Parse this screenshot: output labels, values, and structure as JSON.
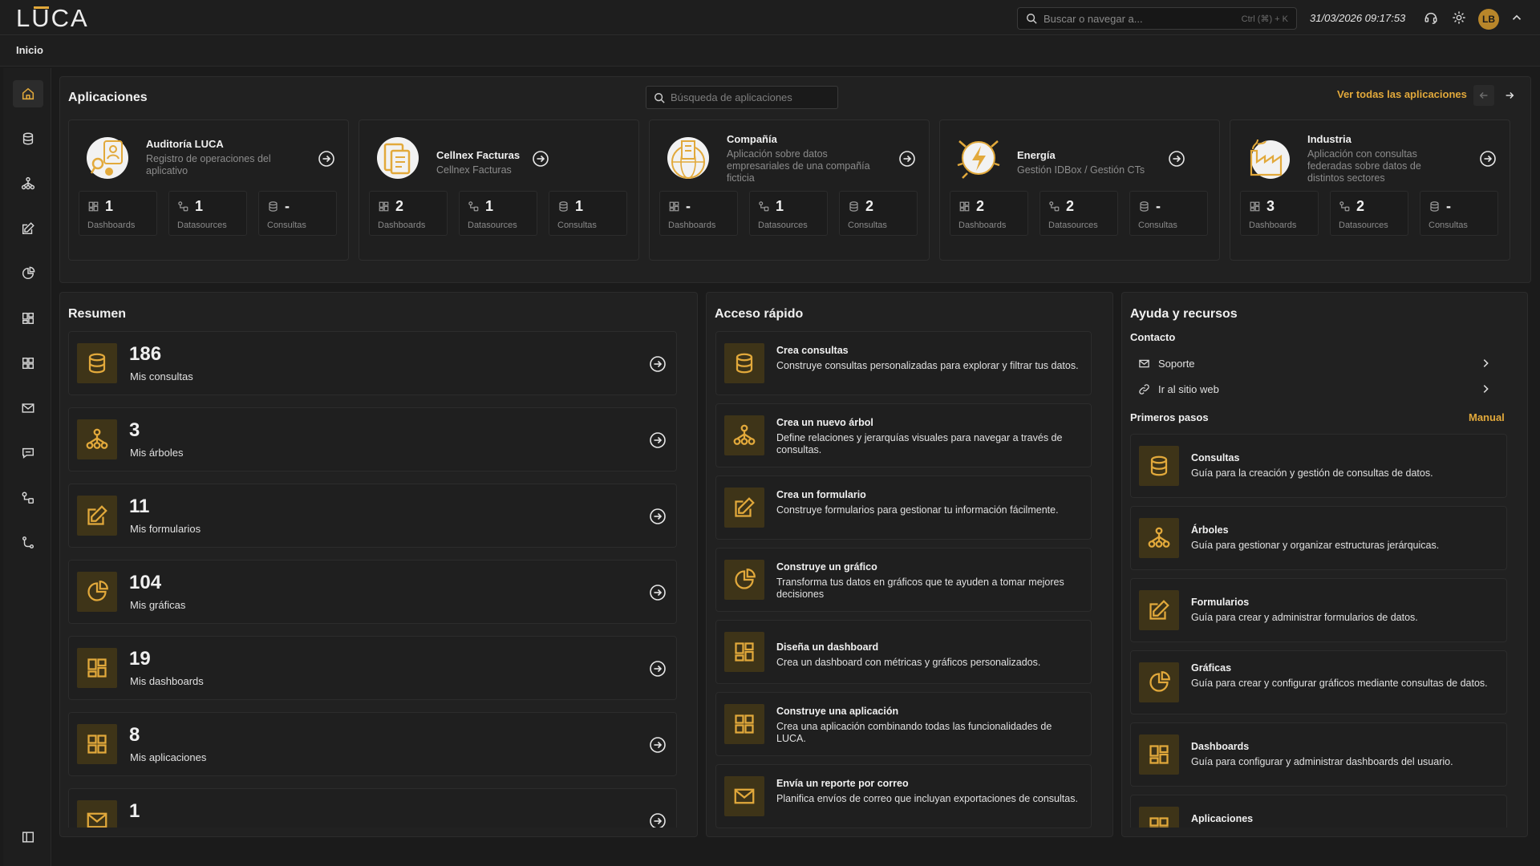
{
  "header": {
    "logo": "LUCA",
    "search_placeholder": "Buscar o navegar a...",
    "search_shortcut": "Ctrl (⌘) + K",
    "datetime": "31/03/2026 09:17:53",
    "avatar_initials": "LB"
  },
  "breadcrumb": "Inicio",
  "sidebar": {
    "items": [
      "home-icon",
      "database-icon",
      "tree-icon",
      "form-icon",
      "chart-icon",
      "dashboard-icon",
      "apps-icon",
      "mail-icon",
      "chat-icon",
      "datasource-icon",
      "workflow-icon"
    ],
    "collapse_icon": "sidebar-collapse-icon"
  },
  "apps": {
    "title": "Aplicaciones",
    "search_placeholder": "Búsqueda de aplicaciones",
    "see_all": "Ver todas las aplicaciones",
    "cards": [
      {
        "name": "Auditoría LUCA",
        "desc": "Registro de operaciones del aplicativo",
        "dashboards": "1",
        "datasources": "1",
        "consultas": "-"
      },
      {
        "name": "Cellnex Facturas",
        "desc": "Cellnex Facturas",
        "dashboards": "2",
        "datasources": "1",
        "consultas": "1"
      },
      {
        "name": "Compañía",
        "desc": "Aplicación sobre datos empresariales de una compañía ficticia",
        "dashboards": "-",
        "datasources": "1",
        "consultas": "2"
      },
      {
        "name": "Energía",
        "desc": "Gestión IDBox / Gestión CTs",
        "dashboards": "2",
        "datasources": "2",
        "consultas": "-"
      },
      {
        "name": "Industria",
        "desc": "Aplicación con consultas federadas sobre datos de distintos sectores",
        "dashboards": "3",
        "datasources": "2",
        "consultas": "-"
      }
    ],
    "stat_labels": {
      "dashboards": "Dashboards",
      "datasources": "Datasources",
      "consultas": "Consultas"
    }
  },
  "summary": {
    "title": "Resumen",
    "rows": [
      {
        "value": "186",
        "label": "Mis consultas",
        "icon": "database-icon"
      },
      {
        "value": "3",
        "label": "Mis árboles",
        "icon": "tree-icon"
      },
      {
        "value": "11",
        "label": "Mis formularios",
        "icon": "form-icon"
      },
      {
        "value": "104",
        "label": "Mis gráficas",
        "icon": "chart-icon"
      },
      {
        "value": "19",
        "label": "Mis dashboards",
        "icon": "dashboard-icon"
      },
      {
        "value": "8",
        "label": "Mis aplicaciones",
        "icon": "apps-icon"
      },
      {
        "value": "1",
        "label": "",
        "icon": "mail-icon"
      }
    ]
  },
  "quick": {
    "title": "Acceso rápido",
    "rows": [
      {
        "title": "Crea consultas",
        "desc": "Construye consultas personalizadas para explorar y filtrar tus datos.",
        "icon": "database-icon"
      },
      {
        "title": "Crea un nuevo árbol",
        "desc": "Define relaciones y jerarquías visuales para navegar a través de consultas.",
        "icon": "tree-icon"
      },
      {
        "title": "Crea un formulario",
        "desc": "Construye formularios para gestionar tu información fácilmente.",
        "icon": "form-icon"
      },
      {
        "title": "Construye un gráfico",
        "desc": "Transforma tus datos en gráficos que te ayuden a tomar mejores decisiones",
        "icon": "chart-icon"
      },
      {
        "title": "Diseña un dashboard",
        "desc": "Crea un dashboard con métricas y gráficos personalizados.",
        "icon": "dashboard-icon"
      },
      {
        "title": "Construye una aplicación",
        "desc": "Crea una aplicación combinando todas las funcionalidades de LUCA.",
        "icon": "apps-icon"
      },
      {
        "title": "Envía un reporte por correo",
        "desc": "Planifica envíos de correo que incluyan exportaciones de consultas.",
        "icon": "mail-icon"
      }
    ]
  },
  "help": {
    "title": "Ayuda y recursos",
    "contact_title": "Contacto",
    "contact": [
      {
        "label": "Soporte",
        "icon": "mail-icon"
      },
      {
        "label": "Ir al sitio web",
        "icon": "link-icon"
      }
    ],
    "first_steps_title": "Primeros pasos",
    "manual": "Manual",
    "guides": [
      {
        "title": "Consultas",
        "desc": "Guía para la creación y gestión de consultas de datos.",
        "icon": "database-icon"
      },
      {
        "title": "Árboles",
        "desc": "Guía para gestionar y organizar estructuras jerárquicas.",
        "icon": "tree-icon"
      },
      {
        "title": "Formularios",
        "desc": "Guía para crear y administrar formularios de datos.",
        "icon": "form-icon"
      },
      {
        "title": "Gráficas",
        "desc": "Guía para crear y configurar gráficos mediante consultas de datos.",
        "icon": "chart-icon"
      },
      {
        "title": "Dashboards",
        "desc": "Guía para configurar y administrar dashboards del usuario.",
        "icon": "dashboard-icon"
      },
      {
        "title": "Aplicaciones",
        "desc": "",
        "icon": "apps-icon"
      }
    ]
  },
  "colors": {
    "accent": "#e2a93b",
    "tile": "#3e3418",
    "background": "#1b1b1b",
    "panel": "#212121"
  }
}
